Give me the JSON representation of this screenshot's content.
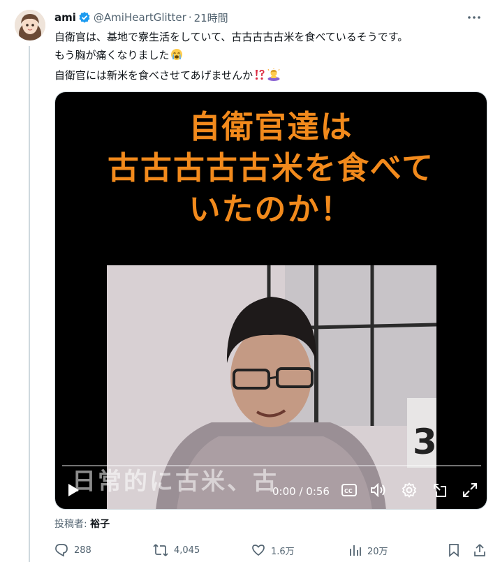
{
  "author": {
    "display_name": "ami",
    "handle": "@AmiHeartGlitter",
    "separator": "·",
    "time": "21時間"
  },
  "tweet": {
    "lines": [
      "自衛官は、基地で寮生活をしていて、古古古古古米を食べているそうです。",
      "もう胸が痛くなりました",
      "自衛官には新米を食べさせてあげませんか"
    ],
    "line2_emoji": "crying-face",
    "line3_emojis": [
      "exclamation-question-mark",
      "person-bowing"
    ]
  },
  "video": {
    "caption_lines": [
      "自衛官達は",
      "古古古古古米を食べて",
      "いたのか！"
    ],
    "subtitle": "日常的に古米、古",
    "time_readout": "0:00 / 0:56",
    "progress": 0
  },
  "posted_by": {
    "label": "投稿者:",
    "name": "裕子"
  },
  "actions": {
    "replies": "288",
    "reposts": "4,045",
    "likes": "1.6万",
    "views": "20万"
  },
  "colors": {
    "accent": "#1d9bf0",
    "caption": "#f28a1c",
    "muted": "#536471"
  }
}
